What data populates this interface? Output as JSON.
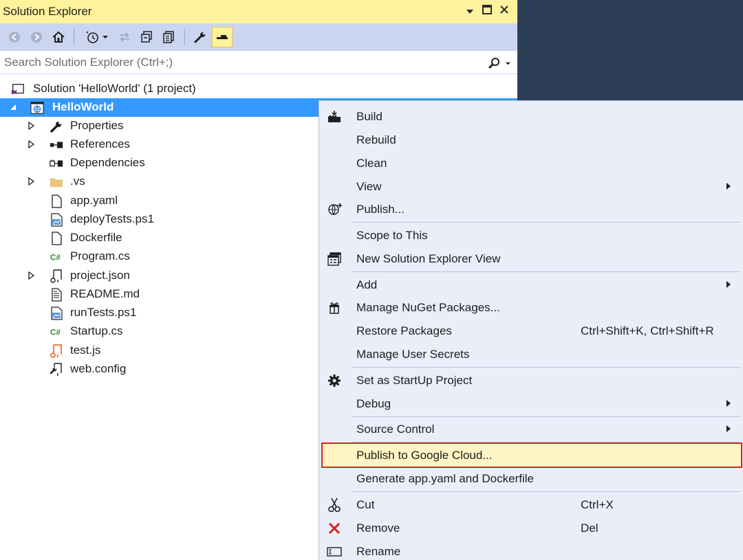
{
  "panel": {
    "title": "Solution Explorer",
    "window_controls": [
      "dropdown",
      "maximize",
      "close"
    ]
  },
  "toolbar": {
    "buttons": [
      "back-icon",
      "forward-icon",
      "home-icon",
      "history-icon",
      "sync-icon",
      "collapse-all-icon",
      "show-all-files-icon",
      "properties-wrench-icon",
      "pin-preview-icon"
    ],
    "active": "pin-preview-icon"
  },
  "search": {
    "placeholder": "Search Solution Explorer (Ctrl+;)"
  },
  "tree": {
    "solution": "Solution 'HelloWorld' (1 project)",
    "project": "HelloWorld",
    "items": [
      {
        "label": "Properties",
        "icon": "wrench-icon",
        "expandable": true
      },
      {
        "label": "References",
        "icon": "references-icon",
        "expandable": true
      },
      {
        "label": "Dependencies",
        "icon": "dependencies-icon",
        "expandable": false
      },
      {
        "label": ".vs",
        "icon": "folder-icon",
        "expandable": true
      },
      {
        "label": "app.yaml",
        "icon": "file-icon",
        "expandable": false
      },
      {
        "label": "deployTests.ps1",
        "icon": "powershell-file-icon",
        "expandable": false
      },
      {
        "label": "Dockerfile",
        "icon": "file-icon",
        "expandable": false
      },
      {
        "label": "Program.cs",
        "icon": "csharp-file-icon",
        "expandable": false
      },
      {
        "label": "project.json",
        "icon": "json-file-icon",
        "expandable": true
      },
      {
        "label": "README.md",
        "icon": "text-file-icon",
        "expandable": false
      },
      {
        "label": "runTests.ps1",
        "icon": "powershell-file-icon",
        "expandable": false
      },
      {
        "label": "Startup.cs",
        "icon": "csharp-file-icon",
        "expandable": false
      },
      {
        "label": "test.js",
        "icon": "js-file-icon",
        "expandable": false
      },
      {
        "label": "web.config",
        "icon": "config-file-icon",
        "expandable": false
      }
    ]
  },
  "context_menu": {
    "items": [
      {
        "label": "Build",
        "icon": "build-icon"
      },
      {
        "label": "Rebuild"
      },
      {
        "label": "Clean"
      },
      {
        "label": "View",
        "submenu": true
      },
      {
        "label": "Publish...",
        "icon": "publish-globe-icon"
      },
      {
        "label": "Scope to This"
      },
      {
        "label": "New Solution Explorer View",
        "icon": "new-explorer-view-icon"
      },
      {
        "label": "Add",
        "submenu": true
      },
      {
        "label": "Manage NuGet Packages...",
        "icon": "nuget-icon"
      },
      {
        "label": "Restore Packages",
        "shortcut": "Ctrl+Shift+K, Ctrl+Shift+R"
      },
      {
        "label": "Manage User Secrets"
      },
      {
        "label": "Set as StartUp Project",
        "icon": "gear-icon"
      },
      {
        "label": "Debug",
        "submenu": true
      },
      {
        "label": "Source Control",
        "submenu": true
      },
      {
        "label": "Publish to Google Cloud...",
        "highlighted": true
      },
      {
        "label": "Generate app.yaml and Dockerfile"
      },
      {
        "label": "Cut",
        "icon": "scissors-icon",
        "shortcut": "Ctrl+X"
      },
      {
        "label": "Remove",
        "icon": "remove-x-icon",
        "shortcut": "Del"
      },
      {
        "label": "Rename",
        "icon": "rename-icon"
      }
    ]
  },
  "colors": {
    "title_bar": "#fff29d",
    "toolbar": "#ccd5f0",
    "selection": "#3399ff",
    "menu_background": "#eaeef9",
    "highlight_border": "#e81c1c",
    "highlight_fill": "#fff4c4",
    "background": "#2d3e57"
  }
}
